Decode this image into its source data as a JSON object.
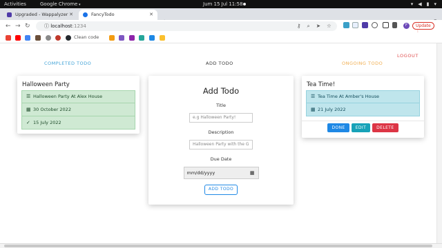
{
  "os": {
    "activities": "Activities",
    "app_name": "Google Chrome",
    "clock": "Jum 15 Jul  11:58"
  },
  "browser": {
    "tabs": [
      {
        "title": "Upgraded - Wappalyzer",
        "active": false
      },
      {
        "title": "FancyTodo",
        "active": true
      }
    ],
    "address": {
      "host": "localhost",
      "port": ":1234"
    },
    "update_label": "Update",
    "avatar_letter": "F",
    "bookmarks": {
      "label": "Clean code"
    }
  },
  "page": {
    "logout": "LOGOUT",
    "columns": {
      "completed": "COMPLETED TODO",
      "add": "ADD TODO",
      "ongoing": "ONGOING TODO"
    },
    "completed_card": {
      "title": "Halloween Party",
      "description": "Halloween Party At Alex House",
      "due_date": "30 October 2022",
      "created": "15 July 2022"
    },
    "form": {
      "title": "Add Todo",
      "title_label": "Title",
      "title_placeholder": "e.g Halloween Party!",
      "description_label": "Description",
      "description_placeholder": "Halloween Party with the G",
      "due_label": "Due Date",
      "due_value": "mm/dd/yyyy",
      "submit": "ADD TODO"
    },
    "ongoing_card": {
      "title": "Tea Time!",
      "description": "Tea Time At Amber's House",
      "due_date": "21 July 2022",
      "done": "DONE",
      "edit": "EDIT",
      "delete": "DELETE"
    }
  },
  "colors": {
    "completed_header": "#3ea1d6",
    "ongoing_header": "#f0ad4e",
    "logout": "#e05050",
    "done": "#1e88e5",
    "edit": "#17a2b8",
    "delete": "#dc3545"
  }
}
